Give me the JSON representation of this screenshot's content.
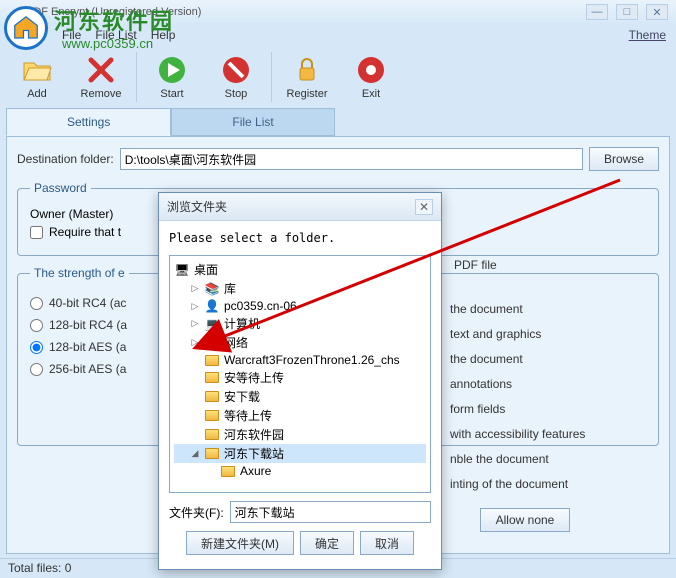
{
  "window": {
    "title": "PDF Encrypt (Unregistered Version)"
  },
  "watermark": {
    "text": "河东软件园",
    "url": "www.pc0359.cn"
  },
  "menu": {
    "file": "File",
    "filelist": "File List",
    "help": "Help",
    "theme": "Theme"
  },
  "toolbar": {
    "add": "Add",
    "remove": "Remove",
    "start": "Start",
    "stop": "Stop",
    "register": "Register",
    "exit": "Exit"
  },
  "tabs": {
    "settings": "Settings",
    "filelist": "File List"
  },
  "dest": {
    "label": "Destination folder:",
    "value": "D:\\tools\\桌面\\河东软件园",
    "browse": "Browse"
  },
  "password": {
    "legend": "Password",
    "owner_label": "Owner (Master)",
    "require_label": "Require that t",
    "pdf_file": "PDF file"
  },
  "strength": {
    "legend": "The strength of e",
    "r1": "40-bit RC4 (ac",
    "r2": "128-bit RC4 (a",
    "r3": "128-bit AES (a",
    "r4": "256-bit AES (a"
  },
  "perms": {
    "p1": "the document",
    "p2": "text and graphics",
    "p3": "the document",
    "p4": "annotations",
    "p5": "form fields",
    "p6": "with accessibility features",
    "p7": "nble the document",
    "p8": "inting of the document",
    "allow_none": "Allow none"
  },
  "status": {
    "total": "Total files: 0"
  },
  "dialog": {
    "title": "浏览文件夹",
    "hint": "Please select a folder.",
    "tree": {
      "desktop": "桌面",
      "libraries": "库",
      "pc0359": "pc0359.cn-06",
      "computer": "计算机",
      "network": "网络",
      "warcraft": "Warcraft3FrozenThrone1.26_chs",
      "wait_upload_an": "安等待上传",
      "download_an": "安下载",
      "wait_upload": "等待上传",
      "hedong": "河东软件园",
      "hedong_dl": "河东下载站",
      "axure": "Axure"
    },
    "folder_label": "文件夹(F):",
    "folder_value": "河东下载站",
    "new_folder": "新建文件夹(M)",
    "ok": "确定",
    "cancel": "取消"
  }
}
